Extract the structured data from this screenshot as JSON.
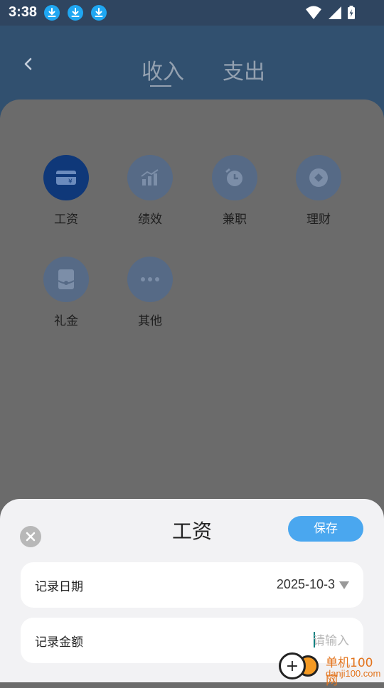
{
  "status_bar": {
    "time": "3:38",
    "download_icons": [
      "download-icon",
      "download-icon",
      "download-icon"
    ],
    "system_icons": [
      "wifi-icon",
      "signal-icon",
      "battery-charging-icon"
    ]
  },
  "header": {
    "back_icon": "chevron-left-icon",
    "tabs": [
      {
        "label": "收入",
        "selected": true
      },
      {
        "label": "支出",
        "selected": false
      }
    ]
  },
  "categories": [
    {
      "label": "工资",
      "icon": "wallet-yen-icon",
      "selected": true
    },
    {
      "label": "绩效",
      "icon": "growth-chart-icon",
      "selected": false
    },
    {
      "label": "兼职",
      "icon": "alarm-clock-icon",
      "selected": false
    },
    {
      "label": "理财",
      "icon": "diamond-coin-icon",
      "selected": false
    },
    {
      "label": "礼金",
      "icon": "red-envelope-icon",
      "selected": false
    },
    {
      "label": "其他",
      "icon": "more-dots-icon",
      "selected": false
    }
  ],
  "sheet": {
    "title": "工资",
    "save_label": "保存",
    "close_icon": "close-icon",
    "date_label": "记录日期",
    "date_value": "2025-10-3",
    "amount_label": "记录金额",
    "amount_placeholder": "请输入",
    "amount_value": ""
  },
  "watermark": {
    "title": "单机100网",
    "url": "danji100.com"
  },
  "colors": {
    "status_bar": "#2f4560",
    "header": "#31506f",
    "overlay": "#6b6b6b",
    "category_circle": "#566a86",
    "category_circle_selected": "#0f3879",
    "save_button": "#4aa7ef",
    "sheet_bg": "#f2f2f4"
  }
}
